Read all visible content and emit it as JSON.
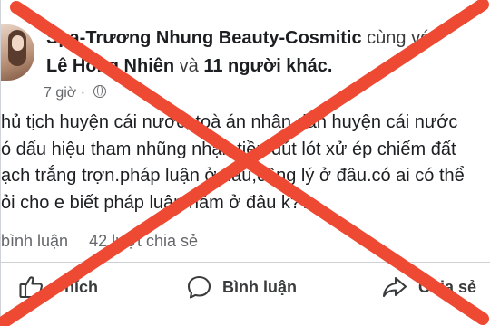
{
  "post": {
    "author": "Spa-Trương Nhung Beauty-Cosmitic",
    "with_text": "cùng với",
    "tagged_person": "Lê Hồng Nhiên",
    "and_text": "và",
    "others": "11 người khác.",
    "time": "7 giờ ·",
    "lines": [
      "hủ tịch huyện cái nước, toà án nhân dân huyện cái nước",
      "ó dấu hiệu tham nhũng nhận tiền đút lót xử ép chiếm đất",
      "ạch trắng trợn.pháp luận ở đâu,công lý ở đâu.có ai có thể",
      "ỏi cho e biết pháp luận nằm ở đâu k??"
    ]
  },
  "stats": {
    "comments": "bình luận",
    "shares": "42 lượt chia sẻ"
  },
  "actions": {
    "like": "Thích",
    "comment": "Bình luận",
    "share": "Chia sẻ"
  },
  "overlay": {
    "cross_color": "#ee4a33"
  },
  "icons": [
    "globe-icon",
    "like-icon",
    "comment-icon",
    "share-icon"
  ]
}
